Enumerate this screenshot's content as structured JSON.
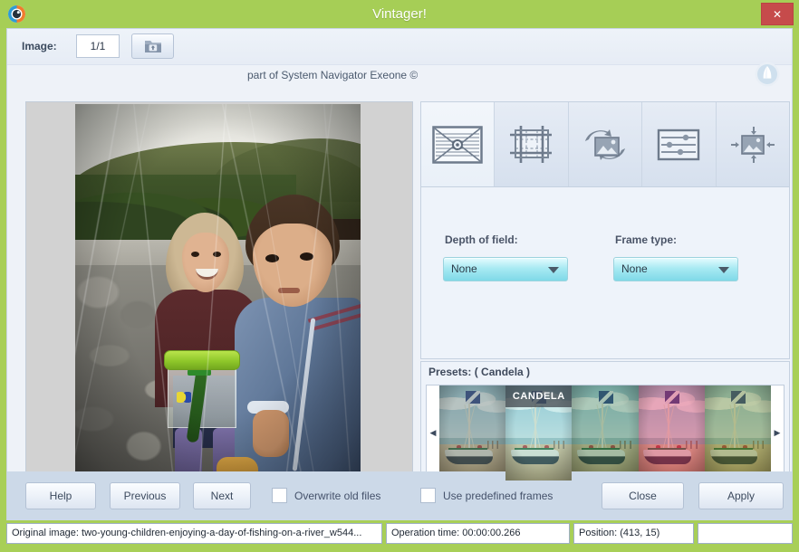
{
  "window": {
    "title": "Vintager!",
    "close_label": "✕",
    "app_icon": "camera-lens-icon",
    "frame_color": "#a6ce56",
    "close_color": "#c64b4b"
  },
  "header": {
    "image_label": "Image:",
    "image_count": "1/1",
    "open_button_icon": "open-folder-icon",
    "subtitle": "part of System Navigator Exeone ©",
    "brand_icon": "sail-logo-icon"
  },
  "preview": {
    "alt": "two young children enjoying a day of fishing on a river",
    "effect": "vintage-scratches-vignette"
  },
  "tabs": [
    {
      "name": "depth-of-field",
      "icon": "vignette-frame-icon",
      "active": true
    },
    {
      "name": "crop",
      "icon": "crop-grid-icon",
      "active": false
    },
    {
      "name": "rotate",
      "icon": "rotate-image-icon",
      "active": false
    },
    {
      "name": "adjust",
      "icon": "sliders-image-icon",
      "active": false
    },
    {
      "name": "resize",
      "icon": "resize-image-icon",
      "active": false
    }
  ],
  "options": {
    "depth_of_field": {
      "label": "Depth of field:",
      "value": "None",
      "options": [
        "None"
      ]
    },
    "frame_type": {
      "label": "Frame type:",
      "value": "None",
      "options": [
        "None"
      ]
    },
    "combo_accent": "#7fd9e8"
  },
  "presets": {
    "title": "Presets: ( Candela )",
    "selected_index": 1,
    "arrow_left": "◀",
    "arrow_right": "▶",
    "items": [
      {
        "name": "preset-1",
        "label": "",
        "tint": "rgba(92,116,108,0.40)",
        "selected": false
      },
      {
        "name": "preset-candela",
        "label": "CANDELA",
        "tint": "rgba(120,214,205,0.26)",
        "selected": true
      },
      {
        "name": "preset-3",
        "label": "",
        "tint": "rgba(58,124,78,0.38)",
        "selected": false
      },
      {
        "name": "preset-4",
        "label": "",
        "tint": "rgba(214,52,96,0.42)",
        "selected": false
      },
      {
        "name": "preset-5",
        "label": "",
        "tint": "rgba(104,134,46,0.42)",
        "selected": false
      }
    ]
  },
  "actions": {
    "help": "Help",
    "previous": "Previous",
    "next": "Next",
    "close": "Close",
    "apply": "Apply",
    "overwrite_old_files": "Overwrite old files",
    "use_predefined_frames": "Use predefined frames",
    "overwrite_checked": false,
    "frames_checked": false
  },
  "status": {
    "file": "Original image: two-young-children-enjoying-a-day-of-fishing-on-a-river_w544...",
    "operation_time": "Operation time: 00:00:00.266",
    "position": "Position: (413, 15)",
    "extra": ""
  }
}
